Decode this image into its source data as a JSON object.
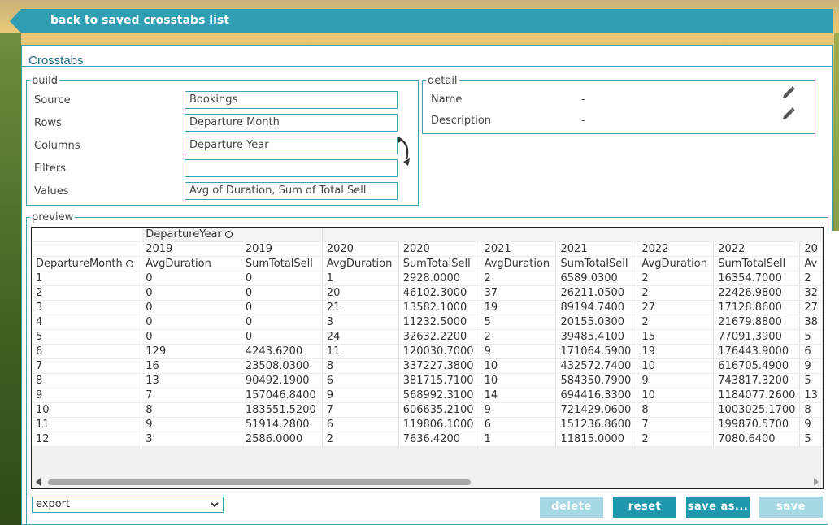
{
  "topbar": {
    "back_label": "back to saved crosstabs list"
  },
  "panel": {
    "title": "Crosstabs"
  },
  "build": {
    "legend": "build",
    "source_label": "Source",
    "source_value": "Bookings",
    "rows_label": "Rows",
    "rows_value": "Departure Month",
    "columns_label": "Columns",
    "columns_value": "Departure Year",
    "filters_label": "Filters",
    "filters_value": "",
    "values_label": "Values",
    "values_value": "Avg of Duration, Sum of Total Sell"
  },
  "detail": {
    "legend": "detail",
    "name_label": "Name",
    "name_value": "-",
    "description_label": "Description",
    "description_value": "-"
  },
  "preview": {
    "legend": "preview",
    "column_field": "DepartureYear",
    "row_field": "DepartureMonth",
    "years": [
      "2019",
      "2019",
      "2020",
      "2020",
      "2021",
      "2021",
      "2022",
      "2022",
      "20"
    ],
    "measures": [
      "AvgDuration",
      "SumTotalSell",
      "AvgDuration",
      "SumTotalSell",
      "AvgDuration",
      "SumTotalSell",
      "AvgDuration",
      "SumTotalSell",
      "Av"
    ],
    "rows": [
      [
        "1",
        "0",
        "0",
        "1",
        "2928.0000",
        "2",
        "6589.0300",
        "2",
        "16354.7000",
        "2"
      ],
      [
        "2",
        "0",
        "0",
        "20",
        "46102.3000",
        "37",
        "26211.0500",
        "2",
        "22426.9800",
        "32"
      ],
      [
        "3",
        "0",
        "0",
        "21",
        "13582.1000",
        "19",
        "89194.7400",
        "27",
        "17128.8600",
        "27"
      ],
      [
        "4",
        "0",
        "0",
        "3",
        "11232.5000",
        "5",
        "20155.0300",
        "2",
        "21679.8800",
        "38"
      ],
      [
        "5",
        "0",
        "0",
        "24",
        "32632.2200",
        "2",
        "39485.4100",
        "15",
        "77091.3900",
        "5"
      ],
      [
        "6",
        "129",
        "4243.6200",
        "11",
        "120030.7000",
        "9",
        "171064.5900",
        "19",
        "176443.9000",
        "6"
      ],
      [
        "7",
        "16",
        "23508.0300",
        "8",
        "337227.3800",
        "10",
        "432572.7400",
        "10",
        "616705.4900",
        "9"
      ],
      [
        "8",
        "13",
        "90492.1900",
        "6",
        "381715.7100",
        "10",
        "584350.7900",
        "9",
        "743817.3200",
        "5"
      ],
      [
        "9",
        "7",
        "157046.8400",
        "9",
        "568992.3100",
        "14",
        "694416.3300",
        "10",
        "1184077.2600",
        "13"
      ],
      [
        "10",
        "8",
        "183551.5200",
        "7",
        "606635.2100",
        "9",
        "721429.0600",
        "8",
        "1003025.1700",
        "8"
      ],
      [
        "11",
        "9",
        "51914.2800",
        "6",
        "119806.1000",
        "6",
        "151236.8600",
        "7",
        "199870.5700",
        "9"
      ],
      [
        "12",
        "3",
        "2586.0000",
        "2",
        "7636.4200",
        "1",
        "11815.0000",
        "2",
        "7080.6400",
        "5"
      ]
    ]
  },
  "footer": {
    "export_value": "export",
    "delete_label": "delete",
    "reset_label": "reset",
    "save_as_label": "save as...",
    "save_label": "save"
  },
  "colors": {
    "accent": "#2f9eb3",
    "border": "#3aa0b2",
    "disabled_button": "#a6d8e4",
    "active_button": "#1f97ad"
  }
}
